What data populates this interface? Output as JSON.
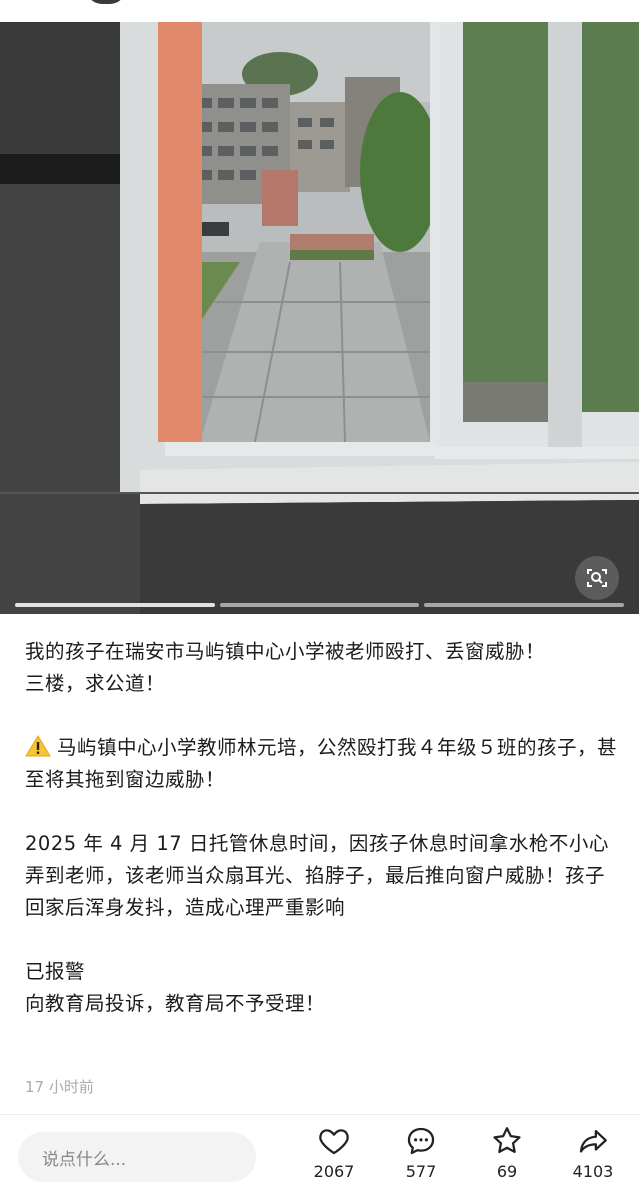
{
  "post": {
    "lines": [
      "我的孩子在瑞安市马屿镇中心小学被老师殴打、丢窗威胁！",
      "三楼，求公道！",
      "马屿镇中心小学教师林元培，公然殴打我４年级５班的孩子，甚至将其拖到窗边威胁！",
      "2025 年 4 月 17 日托管休息时间，因孩子休息时间拿水枪不小心弄到老师，该老师当众扇耳光、掐脖子，最后推向窗户威胁！孩子回家后浑身发抖，造成心理严重影响",
      "已报警",
      "向教育局投诉，教育局不予受理！"
    ],
    "time": "17 小时前"
  },
  "image": {
    "carousel_pages": 3,
    "current_page": 1
  },
  "bottom_bar": {
    "comment_placeholder": "说点什么...",
    "likes": "2067",
    "comments": "577",
    "favorites": "69",
    "shares": "4103"
  },
  "colors": {
    "accent": "#222222",
    "muted": "#aaaaaa",
    "comment_bg": "#f3f3f3"
  }
}
